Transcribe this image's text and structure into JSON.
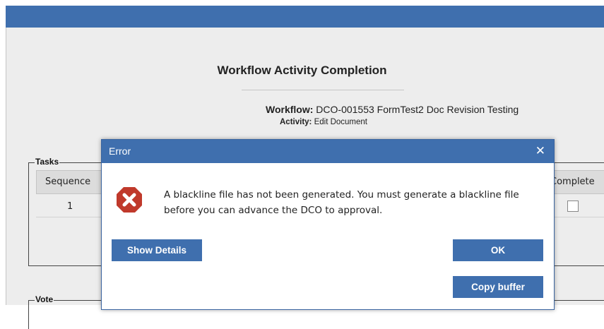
{
  "page": {
    "title": "Workflow Activity Completion",
    "workflow_label": "Workflow:",
    "workflow_value": "DCO-001553 FormTest2 Doc Revision Testing",
    "activity_label": "Activity:",
    "activity_value": "Edit Document"
  },
  "tasks": {
    "legend": "Tasks",
    "columns": {
      "sequence": "Sequence",
      "complete": "Complete"
    },
    "rows": [
      {
        "sequence": "1",
        "complete": false
      }
    ]
  },
  "vote": {
    "legend": "Vote"
  },
  "dialog": {
    "title": "Error",
    "close_icon": "close-icon",
    "error_icon": "error-octagon-icon",
    "message": "A blackline file has not been generated. You must generate a blackline file before you can advance the DCO to approval.",
    "show_details_label": "Show Details",
    "ok_label": "OK",
    "copy_buffer_label": "Copy buffer"
  },
  "colors": {
    "accent": "#3f6fae",
    "error_red": "#c0392b",
    "panel_bg": "#ededed"
  }
}
